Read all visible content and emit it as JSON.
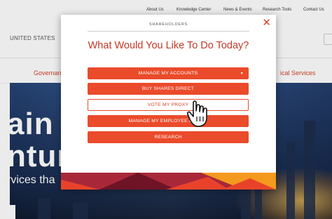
{
  "topnav": {
    "items": [
      "About Us",
      "Knowledge Center",
      "News & Events",
      "Research Tools",
      "Contact Us"
    ]
  },
  "header": {
    "country": "UNITED STATES"
  },
  "menu": {
    "left_item": "Governance",
    "right_item": "ical Services"
  },
  "hero": {
    "line1": "ain Y",
    "line2": "ntur",
    "line3": "rvices tha"
  },
  "modal": {
    "eyebrow": "SHAREHOLDERS",
    "title": "What Would You Like To Do Today?",
    "close_symbol": "✕",
    "options": [
      {
        "label": "MANAGE MY ACCOUNTS",
        "style": "filled",
        "has_caret": true,
        "caret": "▾"
      },
      {
        "label": "BUY SHARES DIRECT",
        "style": "filled"
      },
      {
        "label": "VOTE MY PROXY",
        "style": "outline"
      },
      {
        "label": "MANAGE MY EMPLOYEE EQUITY",
        "style": "filled"
      },
      {
        "label": "RESEARCH",
        "style": "filled"
      }
    ]
  },
  "colors": {
    "accent": "#ea4b2b",
    "title": "#c0392b",
    "band_dark": "#8a1a2a",
    "band_orange": "#f39a1e",
    "band_red": "#e8432a"
  },
  "cursor": {
    "icon": "pointer-hand-icon"
  }
}
